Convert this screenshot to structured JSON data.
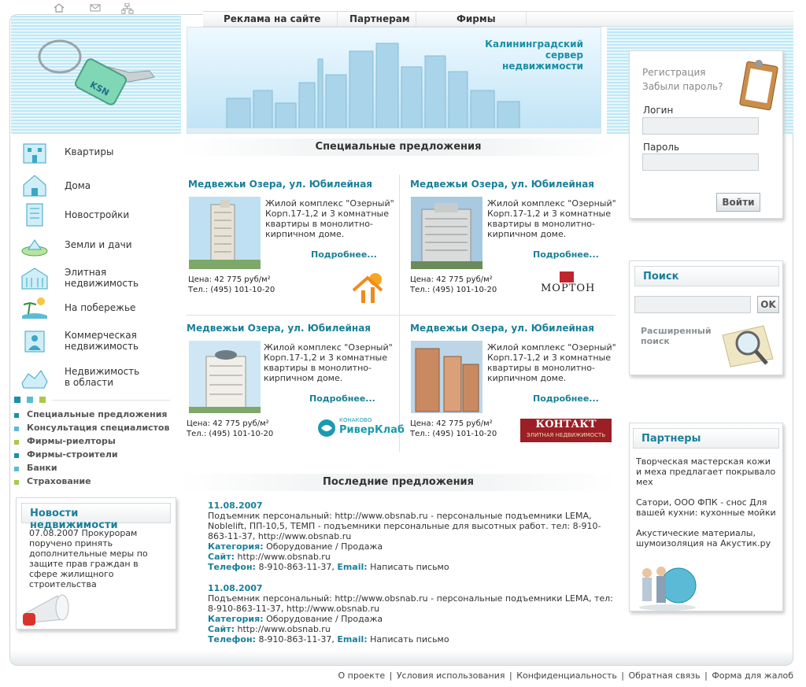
{
  "top_icons": [
    "home-icon",
    "mail-icon",
    "sitemap-icon"
  ],
  "nav": {
    "items": [
      "Реклама на сайте",
      "Партнерам",
      "Фирмы"
    ]
  },
  "banner": {
    "title_lines": [
      "Калининградский",
      "сервер",
      "недвижимости"
    ]
  },
  "logo": {
    "tag_text": "KSN"
  },
  "login": {
    "register": "Регистрация",
    "forgot": "Забыли пароль?",
    "login_label": "Логин",
    "password_label": "Пароль",
    "submit": "Войти"
  },
  "menu": [
    {
      "label": "Квартиры",
      "icon": "apartment-icon"
    },
    {
      "label": "Дома",
      "icon": "house-icon"
    },
    {
      "label": "Новостройки",
      "icon": "new-building-icon"
    },
    {
      "label": "Земли и дачи",
      "icon": "land-icon"
    },
    {
      "label": "Элитная\nнедвижимость",
      "icon": "elite-icon"
    },
    {
      "label": "На побережье",
      "icon": "beach-icon"
    },
    {
      "label": "Коммерческая\nнедвижимость",
      "icon": "commercial-icon"
    },
    {
      "label": "Недвижимость\nв области",
      "icon": "region-icon"
    }
  ],
  "side_links": [
    {
      "label": "Специальные предложения",
      "color": "#1a8fa8"
    },
    {
      "label": "Консультация специалистов",
      "color": "#5bbbd6"
    },
    {
      "label": "Фирмы-риелторы",
      "color": "#a8c94a"
    },
    {
      "label": "Фирмы-строители",
      "color": "#1a8fa8"
    },
    {
      "label": "Банки",
      "color": "#5bbbd6"
    },
    {
      "label": "Страхование",
      "color": "#a8c94a"
    }
  ],
  "news": {
    "heading": "Новости недвижимости",
    "text": "07.08.2007 Прокурорам поручено принять дополнительные меры по защите прав граждан в сфере жилищного строительства"
  },
  "special": {
    "heading": "Специальные предложения",
    "offers": [
      {
        "title": "Медвежьи Озера, ул. Юбилейная",
        "desc": "Жилой комплекс \"Озерный\" Корп.17-1,2 и 3 комнатные квартиры в монолитно-кирпичном доме.",
        "more": "Подробнее...",
        "price": "Цена: 42 775 руб/м²",
        "phone": "Тел.: (495) 101-10-20",
        "logo": "sun-house-logo"
      },
      {
        "title": "Медвежьи Озера, ул. Юбилейная",
        "desc": "Жилой комплекс \"Озерный\" Корп.17-1,2 и 3 комнатные квартиры в монолитно-кирпичном доме.",
        "more": "Подробнее...",
        "price": "Цена: 42 775 руб/м²",
        "phone": "Тел.: (495) 101-10-20",
        "logo_text": "МОРТОН"
      },
      {
        "title": "Медвежьи Озера, ул. Юбилейная",
        "desc": "Жилой комплекс \"Озерный\" Корп.17-1,2 и 3 комнатные квартиры в монолитно-кирпичном доме.",
        "more": "Подробнее...",
        "price": "Цена: 42 775 руб/м²",
        "phone": "Тел.: (495) 101-10-20",
        "logo_text_small": "КОНАКОВО",
        "logo_text": "РиверКлаб"
      },
      {
        "title": "Медвежьи Озера, ул. Юбилейная",
        "desc": "Жилой комплекс \"Озерный\" Корп.17-1,2 и 3 комнатные квартиры в монолитно-кирпичном доме.",
        "more": "Подробнее...",
        "price": "Цена: 42 775 руб/м²",
        "phone": "Тел.: (495) 101-10-20",
        "logo_text": "КОНТАКТ",
        "logo_text_small": "ЭЛИТНАЯ НЕДВИЖИМОСТЬ"
      }
    ]
  },
  "latest": {
    "heading": "Последние предложения",
    "records": [
      {
        "date": "11.08.2007",
        "text": "Подъемник персональный: http://www.obsnab.ru - персональные подъемники LEMA, Noblelift, ПП-10,5, ТЕМП - подъемники персональные для высотных работ. тел: 8-910-863-11-37, http://www.obsnab.ru",
        "cat_label": "Категория:",
        "cat": "Оборудование / Продажа",
        "site_label": "Сайт:",
        "site": "http://www.obsnab.ru",
        "phone_label": "Телефон:",
        "phone": "8-910-863-11-37,",
        "email_label": "Email:",
        "email": "Написать письмо"
      },
      {
        "date": "11.08.2007",
        "text": "Подъемник персональный: http://www.obsnab.ru - персональные подъемники LEMA, тел: 8-910-863-11-37, http://www.obsnab.ru",
        "cat_label": "Категория:",
        "cat": "Оборудование / Продажа",
        "site_label": "Сайт:",
        "site": "http://www.obsnab.ru",
        "phone_label": "Телефон:",
        "phone": "8-910-863-11-37,",
        "email_label": "Email:",
        "email": "Написать письмо"
      }
    ]
  },
  "search": {
    "heading": "Поиск",
    "button": "OK",
    "advanced": "Расширенный поиск"
  },
  "partners": {
    "heading": "Партнеры",
    "items": [
      "Творческая мастерская кожи и меха предлагает покрывало мех",
      "Сатори, ООО ФПК - снос Для вашей кухни: кухонные мойки",
      "Акустические материалы, шумоизоляция на Акустик.ру"
    ]
  },
  "footer": [
    "О проекте",
    "Условия использования",
    "Конфиденциальность",
    "Обратная связь",
    "Форма для жалоб"
  ]
}
